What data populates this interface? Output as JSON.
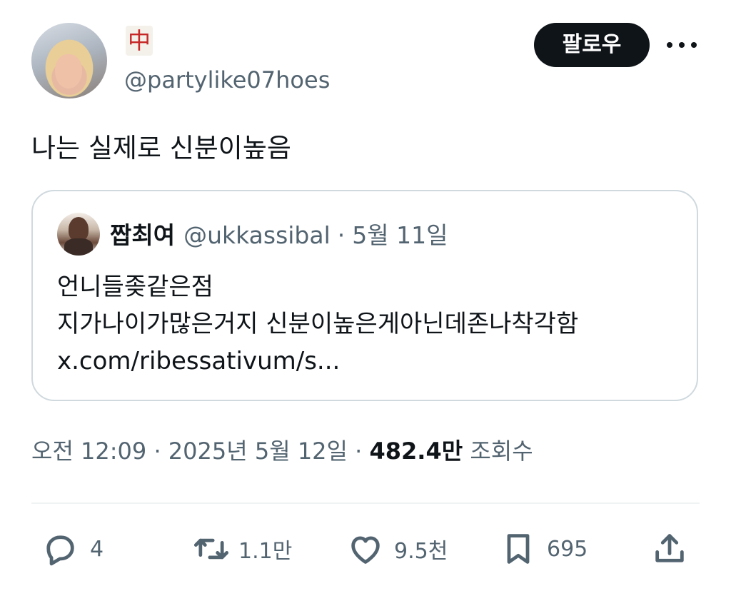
{
  "author": {
    "display_name": "中",
    "handle": "@partylike07hoes"
  },
  "follow_label": "팔로우",
  "tweet_text": "나는 실제로 신분이높음",
  "quoted_tweet": {
    "name": "짭최여",
    "handle": "@ukkassibal",
    "date": "5월 11일",
    "lines": [
      "언니들좆같은점",
      "지가나이가많은거지 신분이높은게아닌데존나착각함",
      "x.com/ribessativum/s..."
    ]
  },
  "meta": {
    "time": "오전 12:09",
    "date": "2025년 5월 12일",
    "views_count": "482.4만",
    "views_label": "조회수"
  },
  "actions": {
    "replies": "4",
    "retweets": "1.1만",
    "likes": "9.5천",
    "bookmarks": "695"
  },
  "colors": {
    "text": "#0f1419",
    "secondary": "#536471",
    "border": "#cfd9de"
  }
}
